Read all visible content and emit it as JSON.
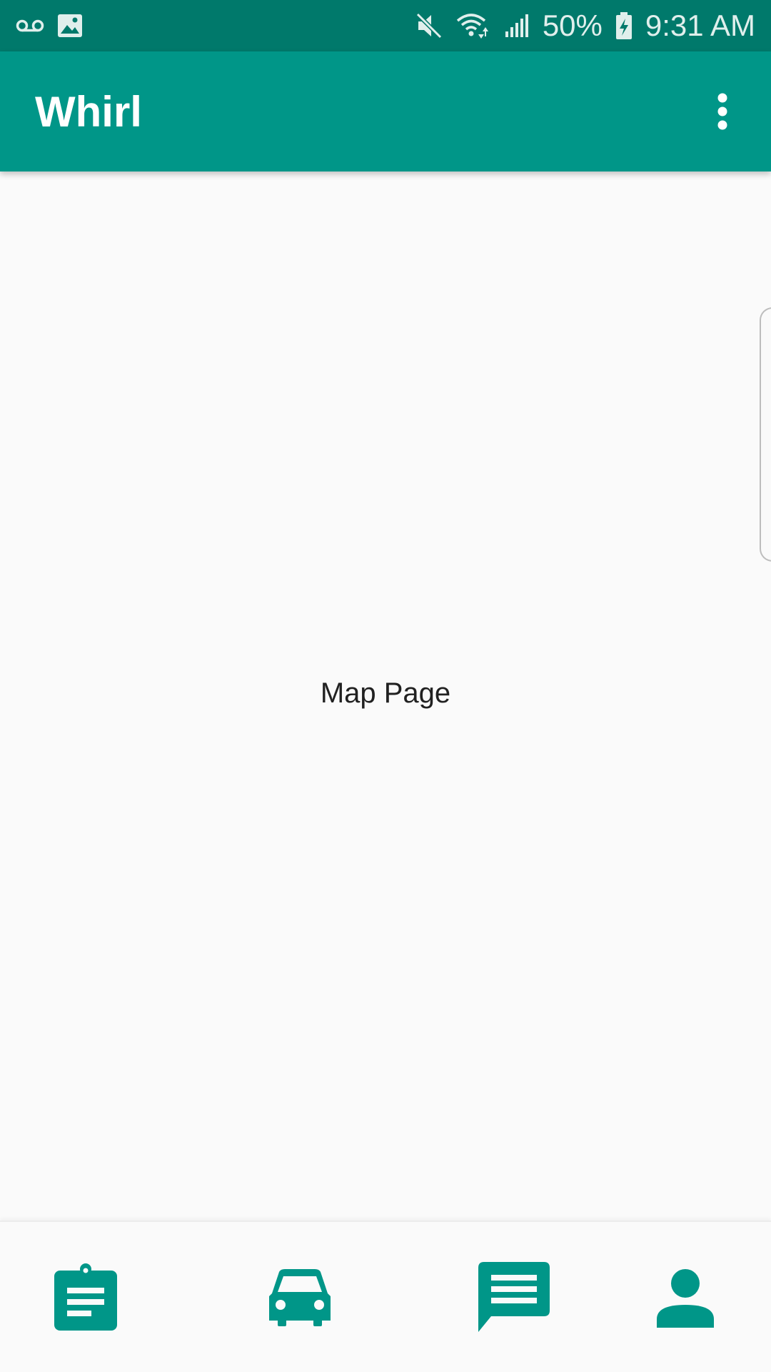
{
  "status_bar": {
    "battery": "50%",
    "time": "9:31 AM",
    "icons_left": [
      "voicemail-icon",
      "image-icon"
    ],
    "icons_right": [
      "mute-icon",
      "wifi-icon",
      "signal-icon",
      "battery-charging-icon"
    ]
  },
  "app_bar": {
    "title": "Whirl",
    "menu_icon": "more-vert-icon"
  },
  "main": {
    "page_label": "Map Page"
  },
  "bottom_nav": {
    "items": [
      {
        "icon": "assignment-icon"
      },
      {
        "icon": "car-icon"
      },
      {
        "icon": "chat-icon"
      },
      {
        "icon": "person-icon"
      }
    ]
  },
  "colors": {
    "status_bar": "#00796b",
    "primary": "#009688",
    "background": "#fafafa",
    "text": "#212121"
  }
}
